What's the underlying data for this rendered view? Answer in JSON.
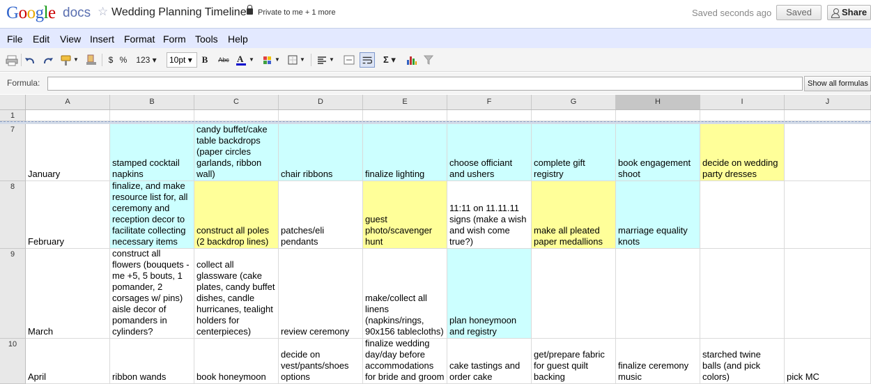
{
  "header": {
    "logo_text": "Google",
    "product": "docs",
    "title": "Wedding Planning Timeline",
    "privacy": "Private to me + 1 more",
    "saved_status": "Saved seconds ago",
    "saved_button": "Saved",
    "share_button": "Share"
  },
  "menu": [
    "File",
    "Edit",
    "View",
    "Insert",
    "Format",
    "Form",
    "Tools",
    "Help"
  ],
  "toolbar": {
    "currency": "$",
    "percent": "%",
    "number_format": "123 ▾",
    "font_size": "10pt ▾",
    "bold": "B",
    "strike": "Abc",
    "sum": "Σ ▾"
  },
  "formula": {
    "label": "Formula:",
    "value": "",
    "show_all": "Show all formulas"
  },
  "columns": [
    "A",
    "B",
    "C",
    "D",
    "E",
    "F",
    "G",
    "H",
    "I",
    "J"
  ],
  "selected_column": "H",
  "colors": {
    "cyan": "#ccffff",
    "yellow": "#ffff99"
  },
  "rows": [
    {
      "num": "1",
      "cells": [
        "",
        "",
        "",
        "",
        "",
        "",
        "",
        "",
        "",
        ""
      ]
    },
    {
      "num": "7",
      "cells": [
        "January",
        "stamped cocktail napkins",
        "candy buffet/cake table backdrops (paper circles garlands, ribbon wall)",
        "chair ribbons",
        "finalize lighting",
        "choose officiant and ushers",
        "complete gift registry",
        "book engagement shoot",
        "decide on wedding party dresses",
        ""
      ]
    },
    {
      "num": "8",
      "cells": [
        "February",
        "finalize, and make resource list for, all ceremony and reception decor to facilitate collecting necessary items",
        "construct all poles (2 backdrop lines)",
        "patches/eli pendants",
        "guest photo/scavenger hunt",
        "11:11 on 11.11.11 signs (make a wish and wish come true?)",
        "make all pleated paper medallions",
        "marriage equality knots",
        "",
        ""
      ]
    },
    {
      "num": "9",
      "cells": [
        "March",
        "construct all flowers (bouquets - me +5, 5 bouts, 1 pomander, 2 corsages w/ pins) aisle decor of pomanders in cylinders?",
        "collect all glassware (cake plates, candy buffet dishes, candle hurricanes, tealight holders for centerpieces)",
        "review ceremony",
        "make/collect all linens (napkins/rings, 90x156 tablecloths)",
        "plan honeymoon and registry",
        "",
        "",
        "",
        ""
      ]
    },
    {
      "num": "10",
      "cells": [
        "April",
        "ribbon wands",
        "book honeymoon",
        "decide on vest/pants/shoes options",
        "finalize wedding day/day before accommodations for bride and groom",
        "cake tastings and order cake",
        "get/prepare fabric for guest quilt backing",
        "finalize ceremony music",
        "starched twine balls (and pick colors)",
        "pick MC"
      ]
    }
  ]
}
